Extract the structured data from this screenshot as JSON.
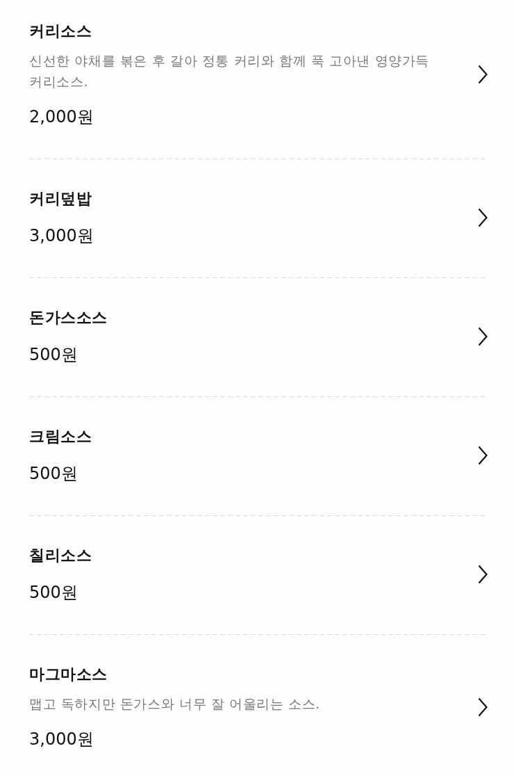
{
  "menu_items": [
    {
      "name": "커리소스",
      "description": "신선한 야채를 볶은 후 갈아 정통 커리와 함께 푹 고아낸 영양가득 커리소스.",
      "price": "2,000원"
    },
    {
      "name": "커리덮밥",
      "price": "3,000원"
    },
    {
      "name": "돈가스소스",
      "price": "500원"
    },
    {
      "name": "크림소스",
      "price": "500원"
    },
    {
      "name": "칠리소스",
      "price": "500원"
    },
    {
      "name": "마그마소스",
      "description": "맵고 독하지만 돈가스와 너무 잘 어울리는 소스.",
      "price": "3,000원"
    }
  ]
}
